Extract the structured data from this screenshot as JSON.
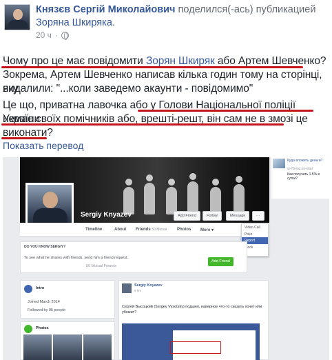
{
  "post": {
    "author": "Князєв Сергій Миколайович",
    "verb": "поделился(-ась) публикацией",
    "shared_page": "Зоряна Шкиряка.",
    "time": "20 ч",
    "privacy_icon": "globe-icon",
    "text": {
      "l1_a": "Чому про це має повідомити ",
      "l1_link": "Зорян Шкиряк",
      "l1_b": " або Артем Шевченко?",
      "l2": "Зокрема, Артем Шевченко написав кілька годин тому на сторінці, яку",
      "l3": "видалили: \"...коли заведемо акаунти - повідомимо\"",
      "l4": "Це що, приватна лавочка або у Голови Національної поліції України",
      "l5": "немає своїх помічників або, врешті-решт, він сам не в змозі це",
      "l6": "виконати?"
    },
    "translate_link": "Показать перевод",
    "underline_color": "#c4161c"
  },
  "screenshot": {
    "profile_name": "Sergiy Knyazev",
    "cover_buttons": [
      "Add Friend",
      "Follow",
      "Message",
      "···"
    ],
    "tabs": [
      "Timeline",
      "About",
      "Friends",
      "Photos",
      "More ▾"
    ],
    "friends_count": "50 Mutual",
    "menu_items": [
      "Video Call",
      "Poke",
      "Report",
      "Block"
    ],
    "menu_selected": "Report",
    "know_header": "DO YOU KNOW SERGIY?",
    "know_text": "To see what he shares with friends, send him a friend request.",
    "mutual_friends": "50 Mutual Friends",
    "add_friend": "Add Friend",
    "intro_header": "Intro",
    "joined": "Joined March 2014",
    "followed_by": "Followed by 95 people",
    "photos_header": "Photos",
    "post_author": "Sergiy Knyazev",
    "post_time": "5 hrs",
    "post_text": "Сергей Высоцкий (Sergey Vysotsky) подшел, наверное что-то сказать хочет или убежит?",
    "sidebar_lines": [
      "Куда вложить деньги?",
      "Как получать 1.5% в сутки?"
    ],
    "sidebar_site": "vi-76-mc.on-vital"
  }
}
